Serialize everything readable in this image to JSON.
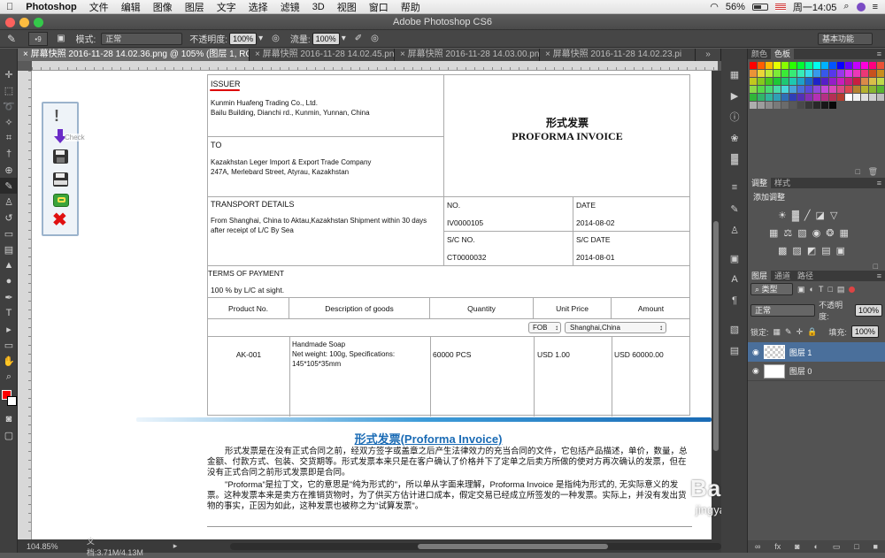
{
  "menubar": {
    "apple": "",
    "app_name": "Photoshop",
    "items": [
      "文件",
      "编辑",
      "图像",
      "图层",
      "文字",
      "选择",
      "滤镜",
      "3D",
      "视图",
      "窗口",
      "帮助"
    ],
    "battery": "56%",
    "clock": "周一14:05"
  },
  "window": {
    "title": "Adobe Photoshop CS6"
  },
  "options": {
    "mode_label": "模式:",
    "mode_value": "正常",
    "opacity_label": "不透明度:",
    "opacity_value": "100%",
    "flow_label": "流量:",
    "flow_value": "100%",
    "brush_size": "9",
    "workspace": "基本功能"
  },
  "tabs": [
    "屏幕快照 2016-11-28 14.02.36.png @ 105% (图层 1, RGB/8*) *",
    "屏幕快照 2016-11-28 14.02.45.png",
    "屏幕快照 2016-11-28 14.03.00.png",
    "屏幕快照 2016-11-28 14.02.23.pi"
  ],
  "status": {
    "zoom": "104.85%",
    "doc": "文档:3.71M/4.13M"
  },
  "widget": {
    "tooltip": "Check"
  },
  "invoice": {
    "issuer_label": "ISSUER",
    "issuer_line1": "Kunmin Huafeng Trading Co., Ltd.",
    "issuer_line2": "Bailu Building, Dianchi rd., Kunmin, Yunnan, China",
    "title_cn": "形式发票",
    "title_en": "PROFORMA INVOICE",
    "to_label": "TO",
    "to_line1": "Kazakhstan Leger Import & Export Trade Company",
    "to_line2": "247A, Merlebard Street, Atyrau, Kazakhstan",
    "transport_label": "TRANSPORT DETAILS",
    "transport_text": "From Shanghai, China to Aktau,Kazakhstan Shipment within 30 days after receipt of L/C By Sea",
    "no_label": "NO.",
    "no_value": "IV0000105",
    "date_label": "DATE",
    "date_value": "2014-08-02",
    "sc_no_label": "S/C NO.",
    "sc_no_value": "CT0000032",
    "sc_date_label": "S/C DATE",
    "sc_date_value": "2014-08-01",
    "terms_label": "TERMS OF PAYMENT",
    "terms_value": "100 % by L/C at sight.",
    "columns": [
      "Product No.",
      "Description of goods",
      "Quantity",
      "Unit Price",
      "Amount"
    ],
    "fob": "FOB",
    "port": "Shanghai,China",
    "row": {
      "product": "AK-001",
      "desc1": "Handmade Soap",
      "desc2": "Net weight: 100g, Specifications:",
      "desc3": "145*105*35mm",
      "qty": "60000 PCS",
      "price": "USD 1.00",
      "amount": "USD 60000.00"
    }
  },
  "article": {
    "heading": "形式发票(Proforma Invoice)",
    "para1": "形式发票是在没有正式合同之前，经双方签字或盖章之后产生法律效力的充当合同的文件，它包括产品描述，单价，数量，总金额、付款方式、包装、交货期等。形式发票本来只是在客户确认了价格并下了定单之后卖方所做的使对方再次确认的发票，但在没有正式合同之前形式发票即是合同。",
    "para2": "\"Proforma\"是拉丁文，它的意思是\"纯为形式的\"，所以单从字面来理解，Proforma Invoice 是指纯为形式的, 无实际意义的发票。这种发票本来是卖方在推销货物时，为了供买方估计进口成本，假定交易已经成立所签发的一种发票。实际上，并没有发出货物的事实，正因为如此，这种发票也被称之为\"试算发票\"。"
  },
  "watermark": {
    "text": "Baidu经验",
    "url": "jingyan.baidu.com"
  },
  "panels": {
    "color_tabs": [
      "颜色",
      "色板"
    ],
    "adjust_tabs": [
      "调整",
      "样式"
    ],
    "adjust_title": "添加调整",
    "layer_tabs": [
      "图层",
      "通道",
      "路径"
    ],
    "kind": "类型",
    "blend": "正常",
    "opacity_label": "不透明度:",
    "opacity_value": "100%",
    "lock_label": "锁定:",
    "fill_label": "填充:",
    "fill_value": "100%",
    "layers": [
      "图层 1",
      "图层 0"
    ]
  },
  "colors": {
    "accent": "#1a6bb5",
    "fg": "#ff0000",
    "bg": "#ffffff"
  }
}
